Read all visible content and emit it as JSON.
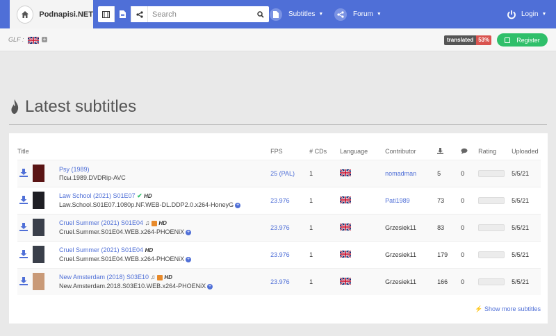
{
  "brand": {
    "name": "Podnapisi.NET"
  },
  "search": {
    "placeholder": "Search"
  },
  "nav": {
    "subtitles": "Subtitles",
    "forum": "Forum",
    "login": "Login"
  },
  "subbar": {
    "glf": "GLF :",
    "translated_label": "translated",
    "translated_pct": "53%",
    "register": "Register"
  },
  "heading": "Latest subtitles",
  "table": {
    "headers": {
      "title": "Title",
      "fps": "FPS",
      "cds": "# CDs",
      "language": "Language",
      "contributor": "Contributor",
      "rating": "Rating",
      "uploaded": "Uploaded"
    },
    "rows": [
      {
        "title": "Psy (1989)",
        "release": "Псы.1989.DVDRip-AVC",
        "fps": "25 (PAL)",
        "cds": "1",
        "contributor": "nomadman",
        "contrib_link": true,
        "downloads": "5",
        "comments": "0",
        "uploaded": "5/5/21",
        "poster": "#5a1414"
      },
      {
        "title": "Law School (2021) S01E07",
        "release": "Law.School.S01E07.1080p.NF.WEB-DL.DDP2.0.x264-HoneyG",
        "fps": "23.976",
        "cds": "1",
        "contributor": "Pati1989",
        "contrib_link": true,
        "downloads": "73",
        "comments": "0",
        "uploaded": "5/5/21",
        "poster": "#1e1e24",
        "check": true,
        "hd": "HD",
        "plus": true
      },
      {
        "title": "Cruel Summer (2021) S01E04",
        "release": "Cruel.Summer.S01E04.WEB.x264-PHOENiX",
        "fps": "23.976",
        "cds": "1",
        "contributor": "Grzesiek11",
        "contrib_link": false,
        "downloads": "83",
        "comments": "0",
        "uploaded": "5/5/21",
        "poster": "#3a3f4a",
        "music": true,
        "cc": true,
        "hd": "HD",
        "plus": true
      },
      {
        "title": "Cruel Summer (2021) S01E04",
        "release": "Cruel.Summer.S01E04.WEB.x264-PHOENiX",
        "fps": "23.976",
        "cds": "1",
        "contributor": "Grzesiek11",
        "contrib_link": false,
        "downloads": "179",
        "comments": "0",
        "uploaded": "5/5/21",
        "poster": "#3a3f4a",
        "hd": "HD",
        "plus": true
      },
      {
        "title": "New Amsterdam (2018) S03E10",
        "release": "New.Amsterdam.2018.S03E10.WEB.x264-PHOENiX",
        "fps": "23.976",
        "cds": "1",
        "contributor": "Grzesiek11",
        "contrib_link": false,
        "downloads": "166",
        "comments": "0",
        "uploaded": "5/5/21",
        "poster": "#c99a78",
        "music": true,
        "cc": true,
        "hd": "HD",
        "plus": true
      }
    ]
  },
  "show_more": "Show more subtitles",
  "colors": {
    "nav": "#4f6fd7",
    "link": "#4f6fd7",
    "register": "#2fbf6a",
    "translated_pct": "#d9534f"
  }
}
